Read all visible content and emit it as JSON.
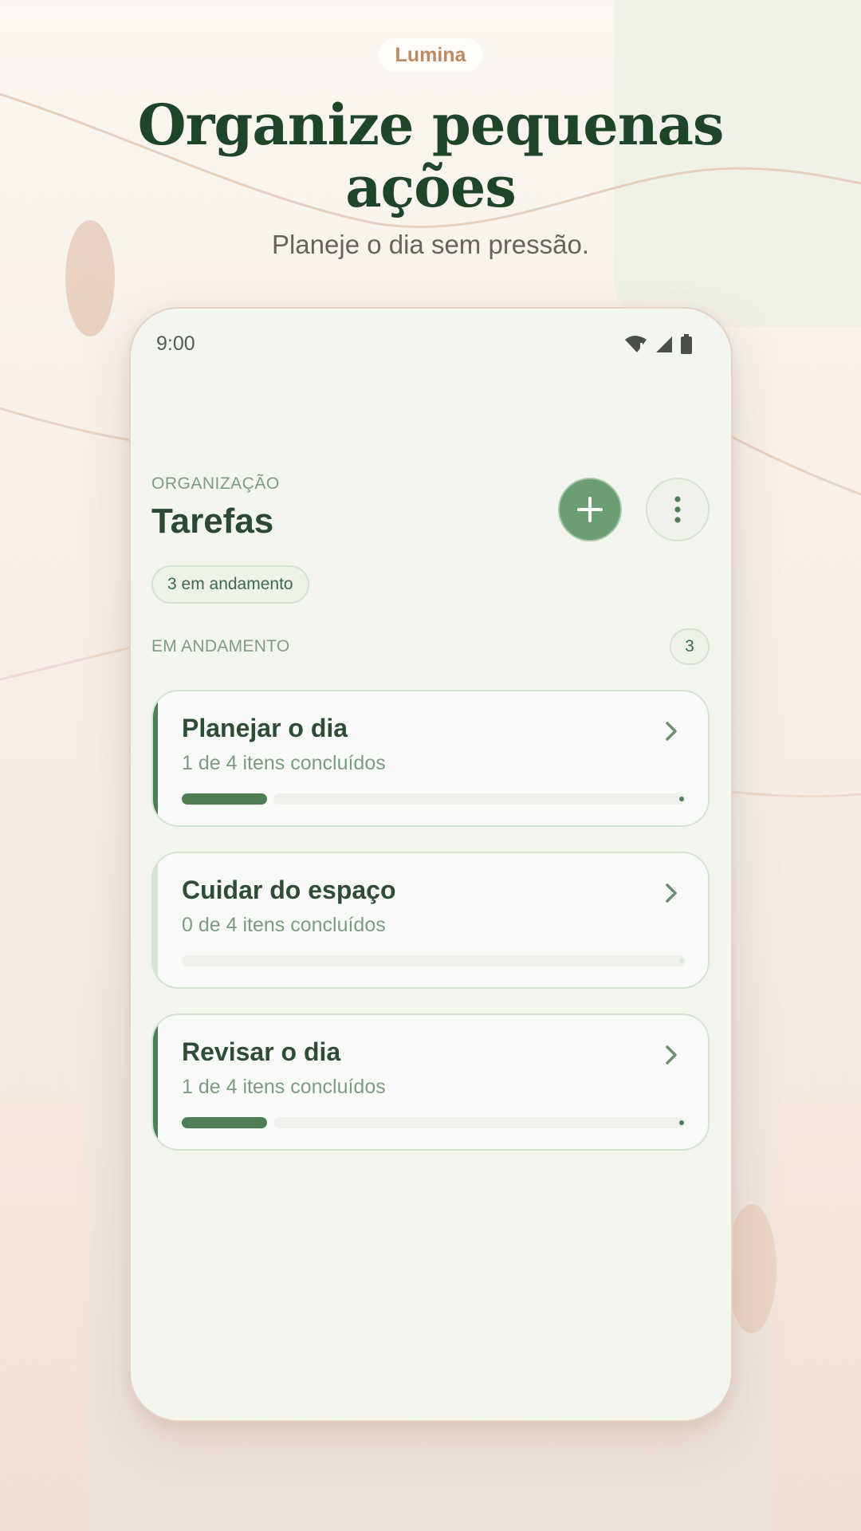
{
  "brand": {
    "name": "Lumina"
  },
  "hero": {
    "title": "Organize pequenas ações",
    "subtitle": "Planeje o dia sem pressão."
  },
  "status_bar": {
    "time": "9:00",
    "icons": [
      "wifi-alert-icon",
      "signal-icon",
      "battery-icon"
    ]
  },
  "header": {
    "eyebrow": "ORGANIZAÇÃO",
    "title": "Tarefas",
    "add_icon": "plus-icon",
    "more_icon": "more-vertical-icon"
  },
  "summary_chip": "3 em andamento",
  "group": {
    "label": "EM ANDAMENTO",
    "count": "3"
  },
  "tasks": [
    {
      "title": "Planejar o dia",
      "subtitle": "1 de 4 itens concluídos",
      "progress": 0.25
    },
    {
      "title": "Cuidar do espaço",
      "subtitle": "0 de 4 itens concluídos",
      "progress": 0
    },
    {
      "title": "Revisar o dia",
      "subtitle": "1 de 4 itens concluídos",
      "progress": 0.25
    }
  ],
  "colors": {
    "accent": "#4e7d56",
    "fab": "#6b9e73",
    "headline": "#1f4529",
    "brand": "#bf8a63"
  }
}
